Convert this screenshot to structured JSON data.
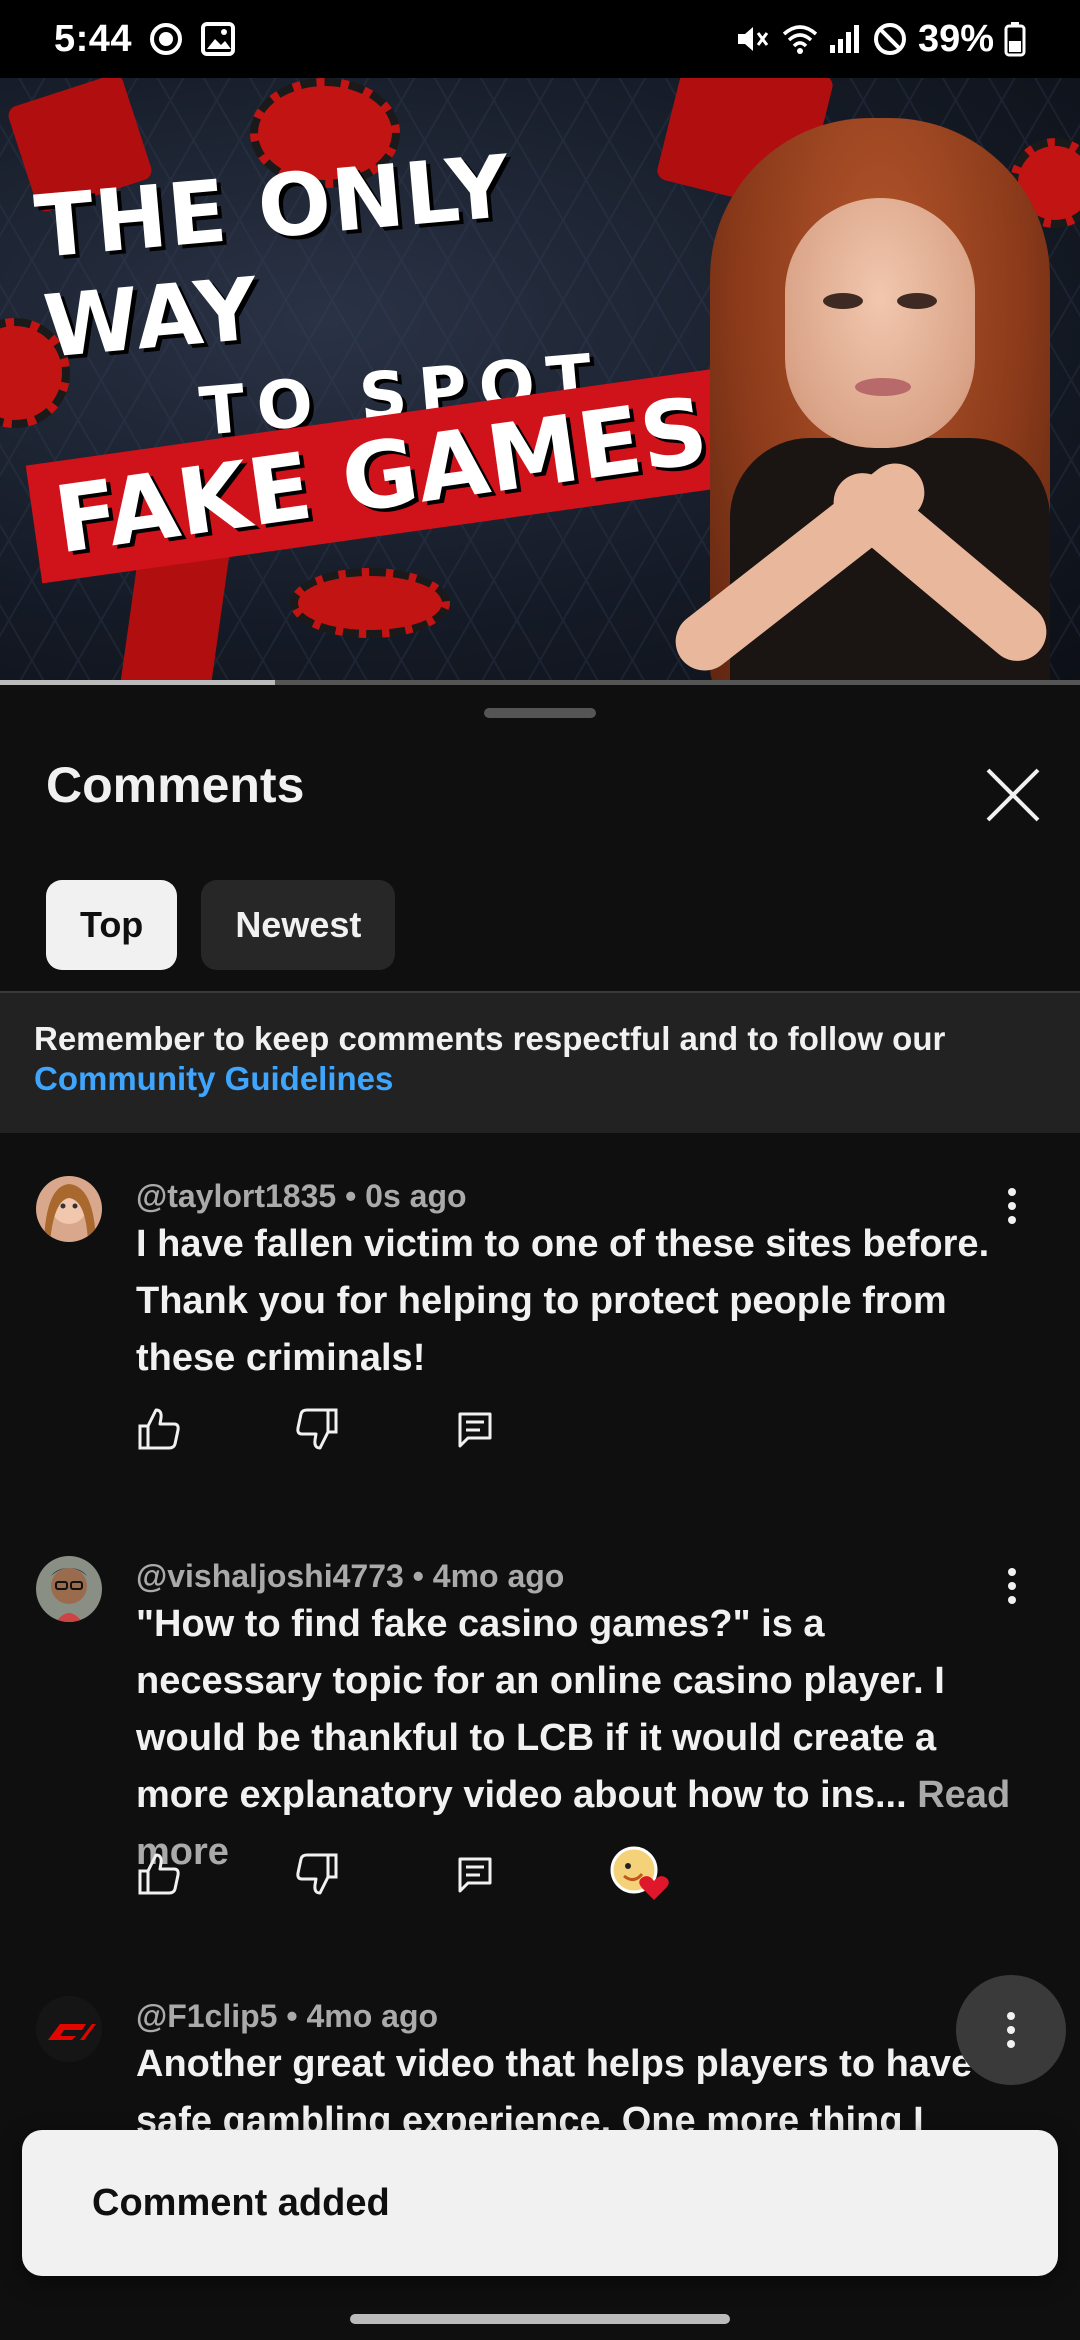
{
  "status_bar": {
    "time": "5:44",
    "battery": "39%"
  },
  "video": {
    "headline_line1": "THE ONLY WAY",
    "headline_line2": "TO SPOT",
    "headline_line3": "FAKE GAMES",
    "progress": 0.255
  },
  "comments_sheet": {
    "title": "Comments",
    "tabs": [
      {
        "label": "Top",
        "selected": true
      },
      {
        "label": "Newest",
        "selected": false
      }
    ],
    "notice_text": "Remember to keep comments respectful and to follow our",
    "notice_link": "Community Guidelines",
    "comments": [
      {
        "author": "@taylort1835",
        "time": "0s ago",
        "text": "I have fallen victim to one of these sites before. Thank you for helping to protect people from these criminals!"
      },
      {
        "author": "@vishaljoshi4773",
        "time": "4mo ago",
        "text": "\"How to find fake casino games?\"   is a necessary topic for an online casino player. I would be thankful to LCB if it would create a more explanatory video about how to ins...",
        "read_more": "Read more",
        "creator_heart": true
      },
      {
        "author": "@F1clip5",
        "time": "4mo ago",
        "text": "Another great video that helps players to have a safe gambling experience. One more thing I"
      }
    ]
  },
  "toast": {
    "message": "Comment added"
  },
  "colors": {
    "accent_link": "#3ea6ff",
    "background": "#0f0f0f",
    "heart": "#e0162b"
  }
}
